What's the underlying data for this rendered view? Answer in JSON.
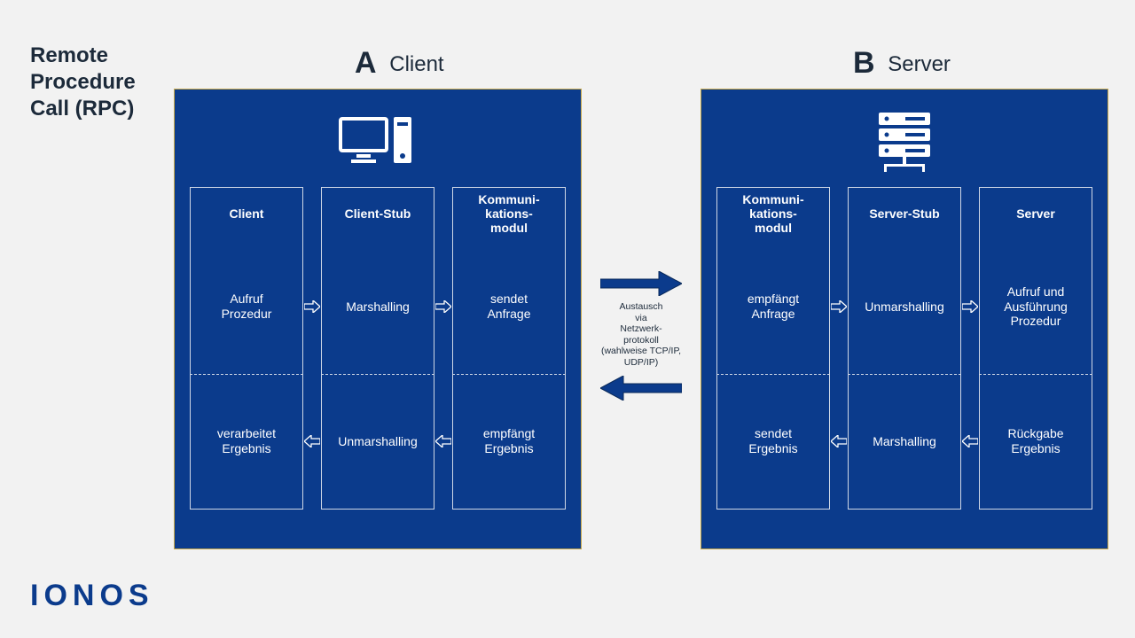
{
  "title": "Remote\nProcedure\nCall (RPC)",
  "logo": "IONOS",
  "colors": {
    "panel": "#0b3b8c",
    "border": "#c6a84a",
    "arrowFill": "#0b3b8c"
  },
  "sides": {
    "a": {
      "letter": "A",
      "label": "Client"
    },
    "b": {
      "letter": "B",
      "label": "Server"
    }
  },
  "client": {
    "columns": [
      {
        "head": "Client",
        "top": "Aufruf\nProzedur",
        "bottom": "verarbeitet\nErgebnis"
      },
      {
        "head": "Client-Stub",
        "top": "Marshalling",
        "bottom": "Unmarshalling"
      },
      {
        "head": "Kommuni-\nkations-\nmodul",
        "top": "sendet\nAnfrage",
        "bottom": "empfängt\nErgebnis"
      }
    ]
  },
  "server": {
    "columns": [
      {
        "head": "Kommuni-\nkations-\nmodul",
        "top": "empfängt\nAnfrage",
        "bottom": "sendet\nErgebnis"
      },
      {
        "head": "Server-Stub",
        "top": "Unmarshalling",
        "bottom": "Marshalling"
      },
      {
        "head": "Server",
        "top": "Aufruf und\nAusführung\nProzedur",
        "bottom": "Rückgabe\nErgebnis"
      }
    ]
  },
  "network": {
    "caption": "Austausch\nvia\nNetzwerk-\nprotokoll\n(wahlweise TCP/IP,\nUDP/IP)"
  }
}
